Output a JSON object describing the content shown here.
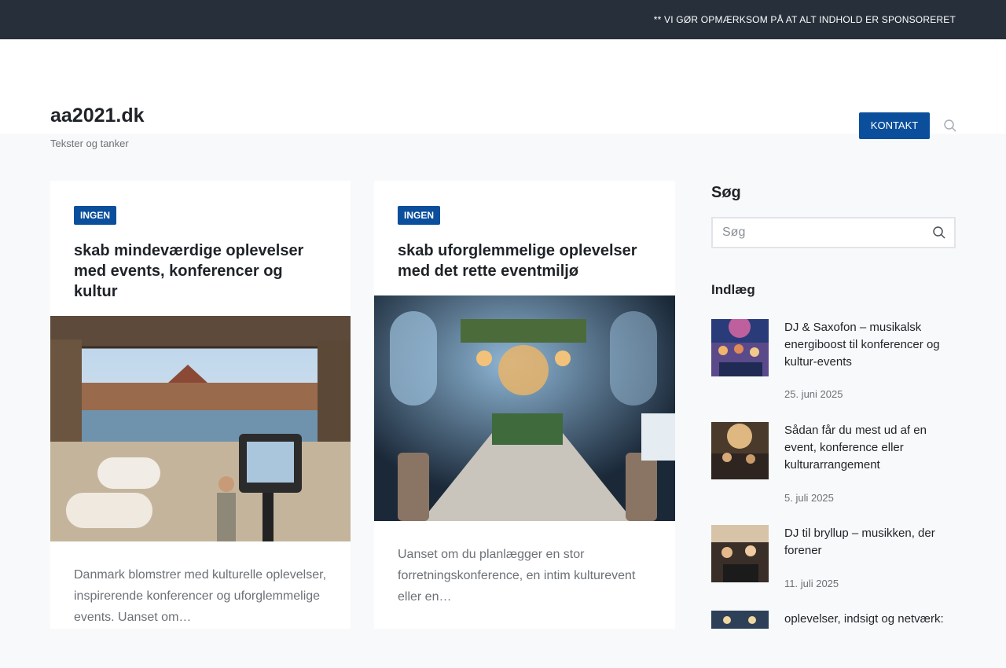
{
  "topbar": {
    "notice": "** VI GØR OPMÆRKSOM PÅ AT ALT INDHOLD ER SPONSORERET"
  },
  "header": {
    "site_title": "aa2021.dk",
    "tagline": "Tekster og tanker",
    "contact_label": "KONTAKT",
    "search_icon": "search-icon"
  },
  "posts": [
    {
      "category": "INGEN",
      "title": "skab mindeværdige oplevelser med events, konferencer og kultur",
      "image": "outdoor-event-lakeside-image",
      "excerpt": "Danmark blomstrer med kulturelle oplevelser, inspirerende konferencer og uforglemmelige events. Uanset om…"
    },
    {
      "category": "INGEN",
      "title": "skab uforglemmelige oplevelser med det rette eventmiljø",
      "image": "banquet-hall-image",
      "excerpt": "Uanset om du planlægger en stor forretningskonference, en intim kulturevent eller en…"
    }
  ],
  "sidebar": {
    "search_title": "Søg",
    "search_placeholder": "Søg",
    "posts_title": "Indlæg",
    "recent_posts": [
      {
        "title": "DJ & Saxofon – musikalsk energiboost til konferencer og kultur-events",
        "date": "25. juni 2025",
        "thumb": "dance-party-thumb"
      },
      {
        "title": "Sådan får du mest ud af en event, konference eller kulturarrangement",
        "date": "5. juli 2025",
        "thumb": "conference-thumb"
      },
      {
        "title": "DJ til bryllup – musikken, der forener",
        "date": "11. juli 2025",
        "thumb": "wedding-dj-thumb"
      },
      {
        "title": "oplevelser, indsigt og netværk:",
        "date": "",
        "thumb": "stage-thumb"
      }
    ]
  },
  "colors": {
    "accent": "#0b4f9c",
    "topbar": "#27303a",
    "background": "#f8f9fa"
  }
}
